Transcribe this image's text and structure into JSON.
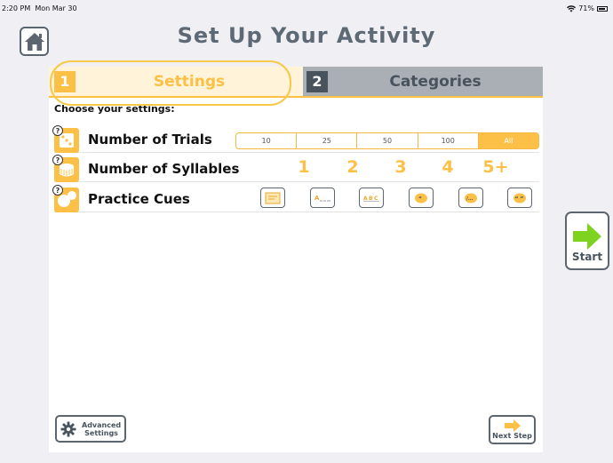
{
  "statusbar": {
    "time": "2:20 PM",
    "date": "Mon Mar 30",
    "battery": "71%"
  },
  "title": "Set Up Your Activity",
  "tabs": [
    {
      "number": "1",
      "label": "Settings",
      "active": true
    },
    {
      "number": "2",
      "label": "Categories",
      "active": false
    }
  ],
  "settings": {
    "heading": "Choose your settings:",
    "help_symbol": "?",
    "trials": {
      "label": "Number of Trials",
      "options": [
        "10",
        "25",
        "50",
        "100",
        "All"
      ],
      "selected": "All"
    },
    "syllables": {
      "label": "Number of Syllables",
      "options": [
        "1",
        "2",
        "3",
        "4",
        "5+"
      ]
    },
    "cues": {
      "label": "Practice Cues",
      "icons": [
        "word-picture-cue-icon",
        "first-letter-cue-icon",
        "letters-cue-icon",
        "first-sound-cue-icon",
        "partial-word-cue-icon",
        "full-word-cue-icon"
      ]
    }
  },
  "buttons": {
    "advanced": "Advanced Settings",
    "advanced_line1": "Advanced",
    "advanced_line2": "Settings",
    "next": "Next Step",
    "start": "Start"
  },
  "colors": {
    "accent": "#fbc045",
    "dark": "#48535e",
    "start_arrow": "#7ed321",
    "next_arrow": "#fbc045"
  }
}
